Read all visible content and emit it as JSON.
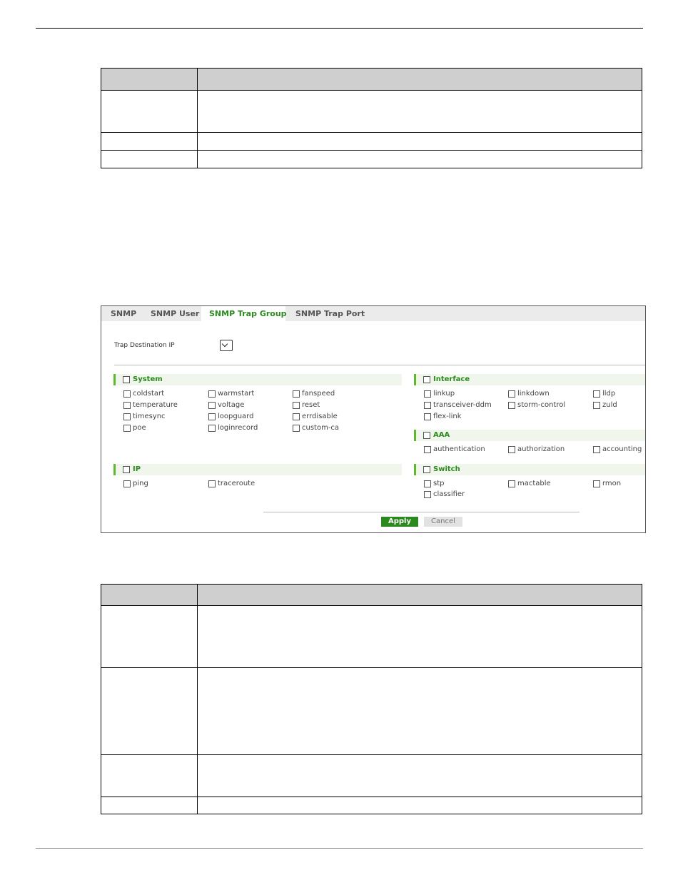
{
  "tabs": [
    {
      "label": "SNMP",
      "active": false
    },
    {
      "label": "SNMP User",
      "active": false
    },
    {
      "label": "SNMP Trap Group",
      "active": true
    },
    {
      "label": "SNMP Trap Port",
      "active": false
    }
  ],
  "trap_destination": {
    "label": "Trap Destination IP",
    "value": ""
  },
  "sections": {
    "system": {
      "title": "System",
      "items": [
        "coldstart",
        "warmstart",
        "fanspeed",
        "temperature",
        "voltage",
        "reset",
        "timesync",
        "loopguard",
        "errdisable",
        "poe",
        "loginrecord",
        "custom-ca"
      ]
    },
    "ip": {
      "title": "IP",
      "items": [
        "ping",
        "traceroute"
      ]
    },
    "interface": {
      "title": "Interface",
      "items": [
        "linkup",
        "linkdown",
        "lldp",
        "transceiver-ddm",
        "storm-control",
        "zuld",
        "flex-link"
      ]
    },
    "aaa": {
      "title": "AAA",
      "items": [
        "authentication",
        "authorization",
        "accounting"
      ]
    },
    "switch": {
      "title": "Switch",
      "items": [
        "stp",
        "mactable",
        "rmon",
        "classifier"
      ]
    }
  },
  "buttons": {
    "apply": "Apply",
    "cancel": "Cancel"
  },
  "colors": {
    "accent": "#2b8a1e",
    "section_bar": "#5cb82d",
    "section_bg": "#f0f6ec"
  }
}
